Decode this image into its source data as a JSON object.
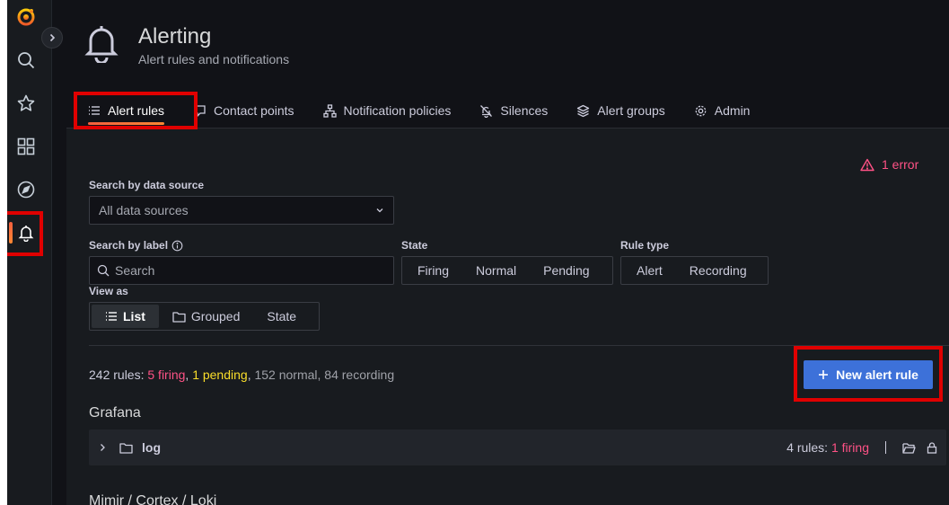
{
  "header": {
    "title": "Alerting",
    "subtitle": "Alert rules and notifications"
  },
  "tabs": [
    {
      "label": "Alert rules",
      "icon": "list-icon"
    },
    {
      "label": "Contact points",
      "icon": "comment-alt-share-icon"
    },
    {
      "label": "Notification policies",
      "icon": "sitemap-icon"
    },
    {
      "label": "Silences",
      "icon": "bell-slash-icon"
    },
    {
      "label": "Alert groups",
      "icon": "layer-group-icon"
    },
    {
      "label": "Admin",
      "icon": "cog-icon"
    }
  ],
  "error": {
    "label": "1 error"
  },
  "filters": {
    "datasource_label": "Search by data source",
    "datasource_value": "All data sources",
    "label_label": "Search by label",
    "search_placeholder": "Search",
    "state_label": "State",
    "state_options": [
      "Firing",
      "Normal",
      "Pending"
    ],
    "rule_type_label": "Rule type",
    "rule_type_options": [
      "Alert",
      "Recording"
    ],
    "view_as_label": "View as",
    "view_as_options": [
      "List",
      "Grouped",
      "State"
    ],
    "view_as_selected": "List"
  },
  "summary": {
    "total": "242 rules:",
    "firing": "5 firing",
    "comma1": ",",
    "pending": "1 pending",
    "comma2": ",",
    "rest": "152 normal, 84 recording"
  },
  "new_rule_button": "New alert rule",
  "groups": [
    {
      "title": "Grafana",
      "folders": [
        {
          "name": "log",
          "count": "4 rules:",
          "firing": "1 firing"
        }
      ]
    },
    {
      "title": "Mimir / Cortex / Loki"
    }
  ],
  "colors": {
    "background": "#111217",
    "panel": "#181b1f",
    "primary": "#3d71d9",
    "firing": "#ff5286",
    "pending": "#fade2a",
    "highlight": "#e00000"
  }
}
